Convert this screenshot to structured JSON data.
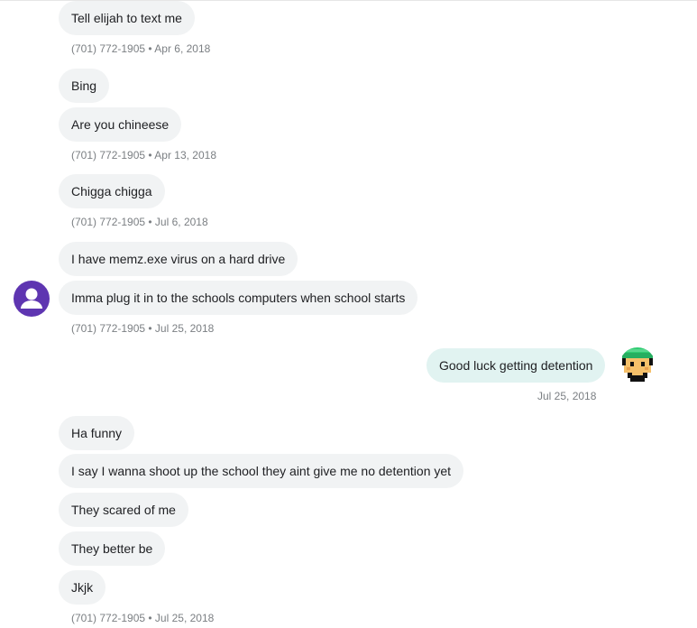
{
  "conversation": {
    "messages": [
      {
        "text": "Tell elijah to text me"
      },
      {
        "text": "Bing"
      },
      {
        "text": "Are you chineese"
      },
      {
        "text": "Chigga chigga"
      },
      {
        "text": "I have memz.exe virus on a hard drive"
      },
      {
        "text": "Imma plug it in to the schools computers when school starts"
      },
      {
        "text": "Good luck getting detention"
      },
      {
        "text": "Ha funny"
      },
      {
        "text": "I say I wanna shoot up the school they aint give me no detention yet"
      },
      {
        "text": "They scared of me"
      },
      {
        "text": "They better be"
      },
      {
        "text": "Jkjk"
      }
    ],
    "meta": [
      {
        "text": "(701) 772-1905 • Apr 6, 2018"
      },
      {
        "text": "(701) 772-1905 • Apr 13, 2018"
      },
      {
        "text": "(701) 772-1905 • Jul 6, 2018"
      },
      {
        "text": "(701) 772-1905 • Jul 25, 2018"
      },
      {
        "text": "Jul 25, 2018"
      },
      {
        "text": "(701) 772-1905 • Jul 25, 2018"
      }
    ],
    "avatars": {
      "incoming": "person-icon",
      "outgoing": "pixel-character-icon"
    }
  },
  "colors": {
    "incoming_bubble": "#f1f3f4",
    "outgoing_bubble": "#e1f3f1",
    "incoming_avatar": "#5e35b1",
    "meta_text": "#7b7f83"
  }
}
